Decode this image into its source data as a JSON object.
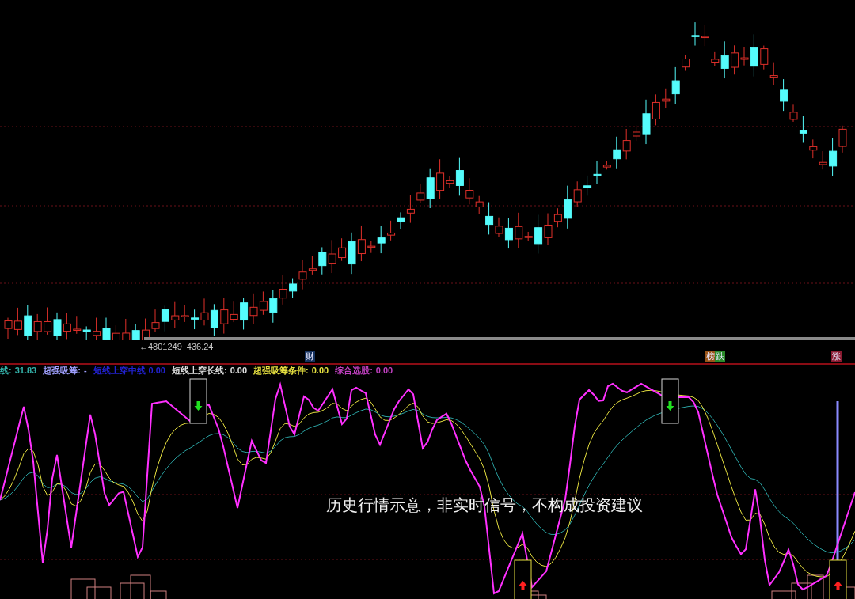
{
  "price_panel": {
    "price_labels": [
      "←4801249",
      "436.24"
    ]
  },
  "markers": [
    {
      "label": "财",
      "color": "#16325e"
    },
    {
      "label": "榜",
      "color": "#9a5418"
    },
    {
      "label": "跌",
      "color": "#2a8a2a"
    },
    {
      "label": "涨",
      "color": "#8a1a30"
    }
  ],
  "legend": [
    {
      "label": "线:",
      "value": "31.83",
      "color": "#33b0a8"
    },
    {
      "label": "超强吸筹:",
      "value": "-",
      "color": "#a0a0ff"
    },
    {
      "label": "短线上穿中线",
      "value": "0.00",
      "color": "#2222d0"
    },
    {
      "label": "短线上穿长线:",
      "value": "0.00",
      "color": "#e0e0e0"
    },
    {
      "label": "超强吸筹条件:",
      "value": "0.00",
      "color": "#e6e040"
    },
    {
      "label": "综合选股:",
      "value": "0.00",
      "color": "#c040c0"
    }
  ],
  "notice": "历史行情示意，非实时信号，不构成投资建议"
}
